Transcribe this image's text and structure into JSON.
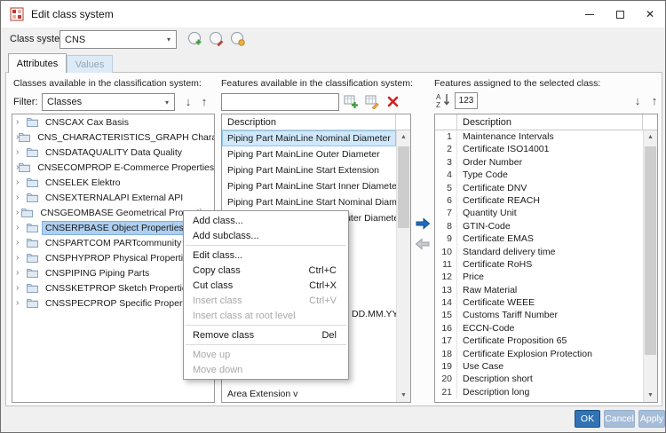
{
  "window": {
    "title": "Edit class system"
  },
  "icons": {
    "close": "✕",
    "combo_arrow": "▾",
    "tree_chevron": "›",
    "arrow_down": "↓",
    "arrow_up": "↑",
    "scroll_up": "▲",
    "scroll_down": "▼"
  },
  "class_system": {
    "label": "Class system:",
    "value": "CNS"
  },
  "tabs": [
    {
      "label": "Attributes"
    },
    {
      "label": "Values"
    }
  ],
  "left_panel": {
    "header": "Classes available in the classification system:",
    "filter_label": "Filter:",
    "filter_value": "Classes",
    "selected_index": 7,
    "items": [
      "CNSCAX Cax Basis",
      "CNS_CHARACTERISTICS_GRAPH Characte...",
      "CNSDATAQUALITY Data Quality",
      "CNSECOMPROP E-Commerce Properties",
      "CNSELEK Elektro",
      "CNSEXTERNALAPI External API",
      "CNSGEOMBASE Geometrical Properties",
      "CNSERPBASE Object Properties",
      "CNSPARTCOM PARTcommunity",
      "CNSPHYPROP Physical Properties",
      "CNSPIPING Piping Parts",
      "CNSSKETPROP Sketch Properties",
      "CNSSPECPROP Specific Properties"
    ]
  },
  "middle_panel": {
    "header": "Features available in the classification system:",
    "search_value": "",
    "column_header": "Description",
    "selected_index": 0,
    "items": [
      "Piping Part MainLine Nominal Diameter",
      "Piping Part MainLine Outer Diameter",
      "Piping Part MainLine Start Extension",
      "Piping Part MainLine Start Inner Diameter",
      "Piping Part MainLine Start Nominal Diameter",
      "Piping Part MainLine Start Outer Diameter"
    ],
    "occluded_fragment": "DD.MM.YYYY)",
    "bottom_item": "Area Extension v"
  },
  "right_panel": {
    "header": "Features assigned to the selected class:",
    "numeric_toggle_label": "123",
    "column_header": "Description",
    "rows": [
      {
        "num": "1",
        "label": "Maintenance Intervals"
      },
      {
        "num": "2",
        "label": "Certificate ISO14001"
      },
      {
        "num": "3",
        "label": "Order Number"
      },
      {
        "num": "4",
        "label": "Type Code"
      },
      {
        "num": "5",
        "label": "Certificate DNV"
      },
      {
        "num": "6",
        "label": "Certificate REACH"
      },
      {
        "num": "7",
        "label": "Quantity Unit"
      },
      {
        "num": "8",
        "label": "GTIN-Code"
      },
      {
        "num": "9",
        "label": "Certificate EMAS"
      },
      {
        "num": "10",
        "label": "Standard delivery time"
      },
      {
        "num": "11",
        "label": "Certificate RoHS"
      },
      {
        "num": "12",
        "label": "Price"
      },
      {
        "num": "13",
        "label": "Raw Material"
      },
      {
        "num": "14",
        "label": "Certificate WEEE"
      },
      {
        "num": "15",
        "label": "Customs Tariff Number"
      },
      {
        "num": "16",
        "label": "ECCN-Code"
      },
      {
        "num": "17",
        "label": "Certificate Proposition 65"
      },
      {
        "num": "18",
        "label": "Certificate Explosion Protection"
      },
      {
        "num": "19",
        "label": "Use Case"
      },
      {
        "num": "20",
        "label": "Description short"
      },
      {
        "num": "21",
        "label": "Description long"
      }
    ]
  },
  "context_menu": {
    "items": [
      {
        "label": "Add class...",
        "enabled": true
      },
      {
        "label": "Add subclass...",
        "enabled": true
      },
      {
        "type": "separator"
      },
      {
        "label": "Edit class...",
        "enabled": true
      },
      {
        "label": "Copy class",
        "shortcut": "Ctrl+C",
        "enabled": true
      },
      {
        "label": "Cut class",
        "shortcut": "Ctrl+X",
        "enabled": true
      },
      {
        "label": "Insert class",
        "shortcut": "Ctrl+V",
        "enabled": false
      },
      {
        "label": "Insert class at root level",
        "enabled": false
      },
      {
        "type": "separator"
      },
      {
        "label": "Remove class",
        "shortcut": "Del",
        "enabled": true
      },
      {
        "type": "separator"
      },
      {
        "label": "Move up",
        "enabled": false
      },
      {
        "label": "Move down",
        "enabled": false
      }
    ]
  },
  "footer": {
    "ok": "OK",
    "cancel": "Cancel",
    "apply": "Apply"
  },
  "colors": {
    "accent": "#3173b5",
    "selection": "#cfe8fc",
    "tree_selection": "#aecff0",
    "danger": "#cc2222",
    "success": "#3a9d3a",
    "assign_arrow": "#1e6bc0"
  }
}
